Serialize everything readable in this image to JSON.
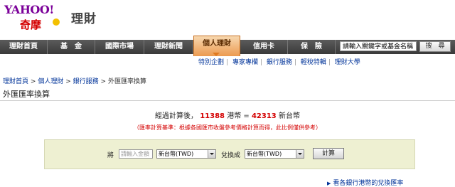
{
  "logo": {
    "yahoo": "YAHOO!",
    "cn": "奇摩"
  },
  "site_name": "理財",
  "nav": {
    "items": [
      "理財首頁",
      "基　金",
      "國際市場",
      "理財新聞",
      "個人理財",
      "信用卡",
      "保　險"
    ],
    "active_index": 4
  },
  "search": {
    "placeholder": "請輸入關鍵字或基金名稱",
    "button": "搜　尋"
  },
  "subnav": [
    "特別企劃",
    "專家專欄",
    "銀行服務",
    "輕稅特輯",
    "理財大學"
  ],
  "breadcrumb": {
    "items": [
      "理財首頁",
      "個人理財",
      "銀行服務"
    ],
    "current": "外匯匯率換算",
    "sep": ">"
  },
  "page_title": "外匯匯率換算",
  "result": {
    "prefix": "經過計算後，",
    "amount_from": "11388",
    "currency_from": "港幣",
    "equals": "=",
    "amount_to": "42313",
    "currency_to": "新台幣"
  },
  "note": "（匯率計算基準：根據各國匯市收盤參考價格計算而得，此比例僅供參考）",
  "form": {
    "label_from": "將",
    "amount_placeholder": "請輸入金額",
    "from_currency": "新台幣(TWD)",
    "label_to": "兌換成",
    "to_currency": "新台幣(TWD)",
    "calc_button": "計算"
  },
  "more_link": "看各銀行港幣的兌換匯率",
  "colors": {
    "accent_red": "#d40000",
    "link_blue": "#003399",
    "nav_bg": "#3a3a3a",
    "panel_bg": "#eef0d2"
  }
}
